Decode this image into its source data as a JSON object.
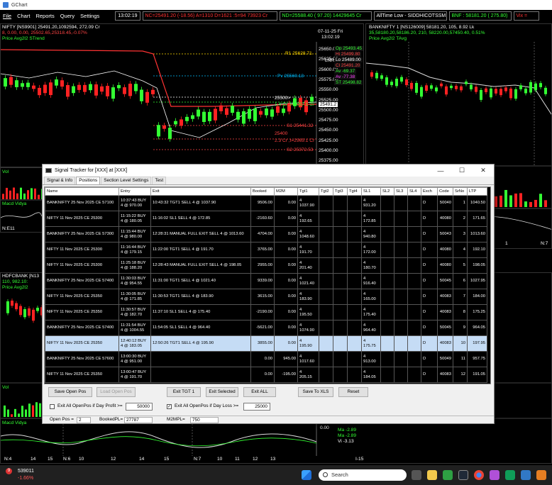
{
  "window": {
    "title": "GChart"
  },
  "menu": [
    "File",
    "Chart",
    "Reports",
    "Query",
    "Settings"
  ],
  "toolbar": {
    "time": "13:02:19",
    "tickers": [
      {
        "text": "NC=25491.20 (-18.56) A=1310 D=1621 :5=94  73923 Cr",
        "color": "#ff3333"
      },
      {
        "text": "ND=25588.40 (  97.20) 14429645 Cr",
        "color": "#33ff33"
      },
      {
        "text": "AllTime Low - SIDDHICOTSSM",
        "color": "#ffffff"
      },
      {
        "text": "BNF : 58181.20 ( 275.80)",
        "color": "#33ff33"
      },
      {
        "text": "Vix = ",
        "color": "#ff3333"
      }
    ]
  },
  "chart_nifty": {
    "symbol_line": "NIFTY [NS9901] 25491.20,1092594, 272.09 Cr",
    "change_line": "8,   0.00,  0.00,  25502.65,25318.45,-0.07%",
    "studies_line": "Price  Avg2l2  STrend",
    "date_label": "07-11-25 Fri",
    "time_label": "13:02:19",
    "lnr": "LNR",
    "levels": {
      "r1": "R1 25628.71",
      "pv": "Pv 25560.13",
      "s1": "S1 25441.32",
      "s2": "S2 25372.53",
      "lvl_25500": "25500>",
      "lvl_25400": "25400",
      "cr_top": "1.4 Cr ,t=2057.1 Cr",
      "cr_bot": "2.3 Cr ,t=2969.1 Cr"
    },
    "axis": [
      "25650.00",
      "25625.00",
      "25600.00",
      "25575.00",
      "25550.00",
      "25525.00",
      "25500.00",
      "25475.00",
      "25450.00",
      "25425.00",
      "25400.00",
      "25375.00",
      "25350.00"
    ],
    "right_box": [
      {
        "text": "Op 25493.45",
        "color": "#33ff33"
      },
      {
        "text": "Hi 25499.80",
        "color": "#ff4444"
      },
      {
        "text": "Lo 25489.00",
        "color": "#ffffff"
      },
      {
        "text": "Cl 25491.20",
        "color": "#ff4444"
      },
      {
        "text": "Av  -69.37",
        "color": "#33ff33"
      },
      {
        "text": "Av  -77.38",
        "color": "#ff44ff"
      },
      {
        "text": "ST 25498.82",
        "color": "#33ff33"
      }
    ],
    "last_price_tag": "25491.2",
    "sub_vol": "Vol",
    "sub_macd": "Macd  Vidya",
    "sub_axis": "N:E11"
  },
  "chart_bank": {
    "symbol_line": "BANKNIFTY 1 [NS126009] 58181.20, 105,  8.92  Lk",
    "change_line": "35,58180.20,58186.20, 210, 58220.00,57450.40, 0.51%",
    "studies_line": "Price  Avg2l2  TAvg",
    "axis_x": [
      "1",
      "N:7"
    ]
  },
  "chart_hdfc": {
    "symbol_line": "HDFCBANK [N13",
    "change_line": "110,  982.10:",
    "studies_line": "Price  Avg2l2",
    "vol": "Vol",
    "macd": "Macd  Vidya",
    "x_labels": [
      "N:4",
      "14",
      "15",
      "N:6",
      "10",
      "12",
      "14",
      "15",
      "N:7",
      "10",
      "11",
      "12",
      "13",
      "I-15"
    ],
    "macd_axis": "0.00",
    "macd_vals": [
      {
        "text": "Ma    -2.89",
        "color": "#33ff33"
      },
      {
        "text": "Ma    -2.89",
        "color": "#33ff33"
      },
      {
        "text": "Vi    -3.13",
        "color": "#ffffff"
      }
    ]
  },
  "dialog": {
    "title": "Signal Tracker for [XXX] at [XXX]",
    "tabs": [
      "Signal & Info",
      "Positions",
      "Section Level Settings",
      "Test"
    ],
    "columns": [
      "Name",
      "Entry",
      "Exit",
      "Booked",
      "M2M",
      "Tgt1",
      "Tgt2",
      "Tgt3",
      "Tgt4",
      "SL1",
      "SL2",
      "SL3",
      "SL4",
      "Exch",
      "Code",
      "SrNo",
      "LTP"
    ],
    "rows": [
      {
        "name": "BANKNIFTY 25 Nov 2025 CE 57100",
        "entry": "10:37:43 BUY\n4 @ 970.00",
        "exit": "10:43:32 TGT1 SELL 4 @  1037.90",
        "booked": "9506.00",
        "m2m": "0.00",
        "tgt1": "4\n1037.90",
        "sl1": "4\n931.20",
        "exch": "D",
        "code": "50040",
        "srno": "1",
        "ltp": "1040.50",
        "selected": false
      },
      {
        "name": "NIFTY 11 Nov 2025 CE 25300",
        "entry": "11:15:22 BUY\n4 @ 180.05",
        "exit": "11:16:02 SL1 SELL 4 @  172.85",
        "booked": "-2160.60",
        "m2m": "0.00",
        "tgt1": "4\n192.65",
        "sl1": "4\n172.85",
        "exch": "D",
        "code": "40080",
        "srno": "2",
        "ltp": "171.65",
        "selected": false
      },
      {
        "name": "BANKNIFTY 25 Nov 2025 CE 57300",
        "entry": "11:15:44 BUY\n4 @ 980.00",
        "exit": "12:28:31 MANUAL FULL EXIT SELL 4 @  1013.60",
        "booked": "4704.00",
        "m2m": "0.00",
        "tgt1": "4\n1048.60",
        "sl1": "4\n940.80",
        "exch": "D",
        "code": "50043",
        "srno": "3",
        "ltp": "1013.60",
        "selected": false
      },
      {
        "name": "NIFTY 11 Nov 2025 CE 25300",
        "entry": "11:16:44 BUY\n4 @ 179.15",
        "exit": "11:22:00 TGT1 SELL 4 @  191.70",
        "booked": "3765.00",
        "m2m": "0.00",
        "tgt1": "4\n191.70",
        "sl1": "4\n172.00",
        "exch": "D",
        "code": "40080",
        "srno": "4",
        "ltp": "192.10",
        "selected": false
      },
      {
        "name": "NIFTY 11 Nov 2025 CE 25300",
        "entry": "11:25:18 BUY\n4 @ 188.20",
        "exit": "12:28:43 MANUAL FULL EXIT SELL 4 @  198.05",
        "booked": "2955.00",
        "m2m": "0.00",
        "tgt1": "4\n201.40",
        "sl1": "4\n180.70",
        "exch": "D",
        "code": "40080",
        "srno": "5",
        "ltp": "198.05",
        "selected": false
      },
      {
        "name": "BANKNIFTY 25 Nov 2025 CE 57400",
        "entry": "11:30:03 BUY\n4 @ 954.55",
        "exit": "11:31:00 TGT1 SELL 4 @  1021.40",
        "booked": "9339.00",
        "m2m": "0.00",
        "tgt1": "4\n1021.40",
        "sl1": "4\n916.40",
        "exch": "D",
        "code": "50045",
        "srno": "6",
        "ltp": "1027.95",
        "selected": false
      },
      {
        "name": "NIFTY 11 Nov 2025 CE 25350",
        "entry": "11:30:05 BUY\n4 @ 171.85",
        "exit": "11:30:53 TGT1 SELL 4 @  183.90",
        "booked": "3615.00",
        "m2m": "0.00",
        "tgt1": "4\n183.90",
        "sl1": "4\n165.00",
        "exch": "D",
        "code": "40083",
        "srno": "7",
        "ltp": "184.00",
        "selected": false
      },
      {
        "name": "NIFTY 11 Nov 2025 CE 25350",
        "entry": "11:30:57 BUY\n4 @ 182.70",
        "exit": "11:37:10 SL1 SELL 4 @  175.40",
        "booked": "-2190.00",
        "m2m": "0.00",
        "tgt1": "4\n195.50",
        "sl1": "4\n175.40",
        "exch": "D",
        "code": "40083",
        "srno": "8",
        "ltp": "175.25",
        "selected": false
      },
      {
        "name": "BANKNIFTY 25 Nov 2025 CE 57400",
        "entry": "11:31:54 BUY\n4 @ 1004.55",
        "exit": "11:54:05 SL1 SELL 4 @  964.40",
        "booked": "-5621.00",
        "m2m": "0.00",
        "tgt1": "4\n1074.90",
        "sl1": "4\n964.40",
        "exch": "D",
        "code": "50045",
        "srno": "9",
        "ltp": "964.05",
        "selected": false
      },
      {
        "name": "NIFTY 11 Nov 2025 CE 25350",
        "entry": "12:40:12 BUY\n4 @ 183.05",
        "exit": "12:50:26 TGT1 SELL 4 @  195.90",
        "booked": "3855.00",
        "m2m": "0.00",
        "tgt1": "4\n195.90",
        "sl1": "4\n175.75",
        "exch": "D",
        "code": "40083",
        "srno": "10",
        "ltp": "197.95",
        "selected": true
      },
      {
        "name": "BANKNIFTY 25 Nov 2025 CE 57600",
        "entry": "13:00:30 BUY\n4 @ 951.00",
        "exit": "",
        "booked": "0.00",
        "m2m": "945.00",
        "tgt1": "4\n1017.60",
        "sl1": "4\n913.00",
        "exch": "D",
        "code": "50049",
        "srno": "11",
        "ltp": "957.75",
        "selected": false
      },
      {
        "name": "NIFTY 11 Nov 2025 CE 25350",
        "entry": "13:00:47 BUY\n4 @ 191.70",
        "exit": "",
        "booked": "0.00",
        "m2m": "-195.00",
        "tgt1": "4\n205.15",
        "sl1": "4\n184.05",
        "exch": "D",
        "code": "40083",
        "srno": "12",
        "ltp": "191.05",
        "selected": false
      }
    ],
    "buttons": {
      "save_open_pos": "Save Open Pos",
      "load_open_pos": "Load Open Pos",
      "exit_tgt1": "Exit TGT 1",
      "exit_selected": "Exit Selected",
      "exit_all": "Exit ALL",
      "save_xls": "Save To XLS",
      "reset": "Reset"
    },
    "options": {
      "profit_label": "Exit All OpenPos if Day Profit >=",
      "profit_value": "50000",
      "profit_checked": false,
      "loss_label": "Exit All OpenPos if Day Loss >=",
      "loss_value": "25000",
      "loss_checked": true
    },
    "status": {
      "open_pos_label": "Open Pos =",
      "open_pos_value": "2",
      "booked_label": "BookedPL=",
      "booked_value": "27787",
      "m2m_label": "M2MPL=",
      "m2m_value": "750"
    }
  },
  "taskbar": {
    "stock_value": "539011",
    "stock_change": "-1.66%",
    "search_placeholder": "Search",
    "notify_badge": "9"
  }
}
